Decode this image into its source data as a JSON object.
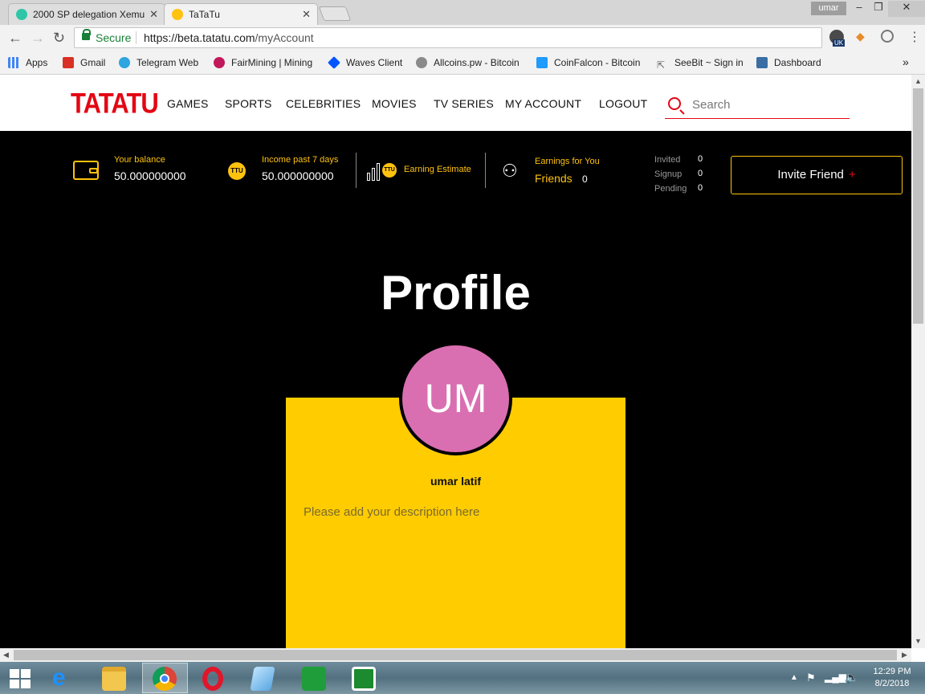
{
  "browser": {
    "tabs": [
      {
        "title": "2000 SP delegation Xemu",
        "active": false,
        "favicon_color": "#2fc6a8"
      },
      {
        "title": "TaTaTu",
        "active": true,
        "favicon_color": "#ffc20e"
      }
    ],
    "window_user": "umar",
    "secure_label": "Secure",
    "url_scheme_host": "https://beta.tatatu.com",
    "url_path": "/myAccount",
    "extension_badge": "UK",
    "bookmarks": [
      {
        "label": "Apps",
        "icon": "apps-grid-icon",
        "color": "#4285f4"
      },
      {
        "label": "Gmail",
        "icon": "gmail-icon",
        "color": "#d93025"
      },
      {
        "label": "Telegram Web",
        "icon": "telegram-icon",
        "color": "#2ca5e0"
      },
      {
        "label": "FairMining | Mining",
        "icon": "fairmining-icon",
        "color": "#c2185b"
      },
      {
        "label": "Waves Client",
        "icon": "waves-icon",
        "color": "#0055ff"
      },
      {
        "label": "Allcoins.pw - Bitcoin",
        "icon": "allcoins-icon",
        "color": "#8a8a8a"
      },
      {
        "label": "CoinFalcon - Bitcoin",
        "icon": "coinfalcon-icon",
        "color": "#1e9bff"
      },
      {
        "label": "SeeBit ~ Sign in",
        "icon": "seebit-icon",
        "color": "#666666"
      },
      {
        "label": "Dashboard",
        "icon": "dashboard-icon",
        "color": "#3a6ea5"
      }
    ]
  },
  "site": {
    "logo": "TATATU",
    "nav": [
      "GAMES",
      "SPORTS",
      "CELEBRITIES",
      "MOVIES",
      "TV SERIES",
      "MY ACCOUNT",
      "LOGOUT"
    ],
    "search_placeholder": "Search",
    "accent": "#ffc20e",
    "brand_red": "#e30613"
  },
  "stats": {
    "balance_label": "Your balance",
    "balance_value": "50.000000000",
    "income_label": "Income past 7 days",
    "income_value": "50.000000000",
    "coin_symbol": "TTU",
    "earning_estimate": "Earning Estimate",
    "earnings_for_you": "Earnings for You",
    "friends_label": "Friends",
    "friends_value": "0",
    "invited_label": "Invited",
    "invited_value": "0",
    "signup_label": "Signup",
    "signup_value": "0",
    "pending_label": "Pending",
    "pending_value": "0",
    "invite_button": "Invite Friend",
    "invite_plus": "+"
  },
  "profile": {
    "title": "Profile",
    "initials": "UM",
    "avatar_color": "#d96fb1",
    "name": "umar latif",
    "description_placeholder": "Please add your description here"
  },
  "taskbar": {
    "time": "12:29 PM",
    "date": "8/2/2018"
  }
}
